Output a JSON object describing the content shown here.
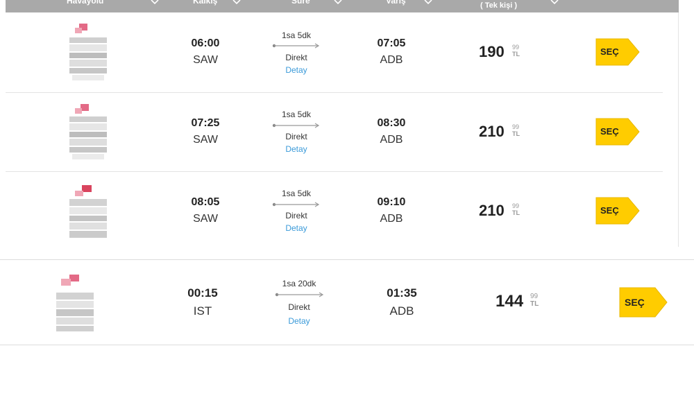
{
  "header": {
    "columns": [
      {
        "label": "Havayolu"
      },
      {
        "label": "Kalkış"
      },
      {
        "label": "Süre"
      },
      {
        "label": "Varış"
      },
      {
        "label": "( Tek kişi )"
      }
    ]
  },
  "flights": [
    {
      "dep_time": "06:00",
      "dep_code": "SAW",
      "duration": "1sa 5dk",
      "type": "Direkt",
      "detail": "Detay",
      "arr_time": "07:05",
      "arr_code": "ADB",
      "price": "190",
      "cents": "99",
      "currency": "TL",
      "select": "SEÇ"
    },
    {
      "dep_time": "07:25",
      "dep_code": "SAW",
      "duration": "1sa 5dk",
      "type": "Direkt",
      "detail": "Detay",
      "arr_time": "08:30",
      "arr_code": "ADB",
      "price": "210",
      "cents": "99",
      "currency": "TL",
      "select": "SEÇ"
    },
    {
      "dep_time": "08:05",
      "dep_code": "SAW",
      "duration": "1sa 5dk",
      "type": "Direkt",
      "detail": "Detay",
      "arr_time": "09:10",
      "arr_code": "ADB",
      "price": "210",
      "cents": "99",
      "currency": "TL",
      "select": "SEÇ"
    },
    {
      "dep_time": "00:15",
      "dep_code": "IST",
      "duration": "1sa 20dk",
      "type": "Direkt",
      "detail": "Detay",
      "arr_time": "01:35",
      "arr_code": "ADB",
      "price": "144",
      "cents": "99",
      "currency": "TL",
      "select": "SEÇ"
    }
  ],
  "colors": {
    "header_bg": "#a9a9a9",
    "select_button": "#ffcc00",
    "detail_link": "#3a9ad9",
    "logo_accent": "#e05570"
  }
}
